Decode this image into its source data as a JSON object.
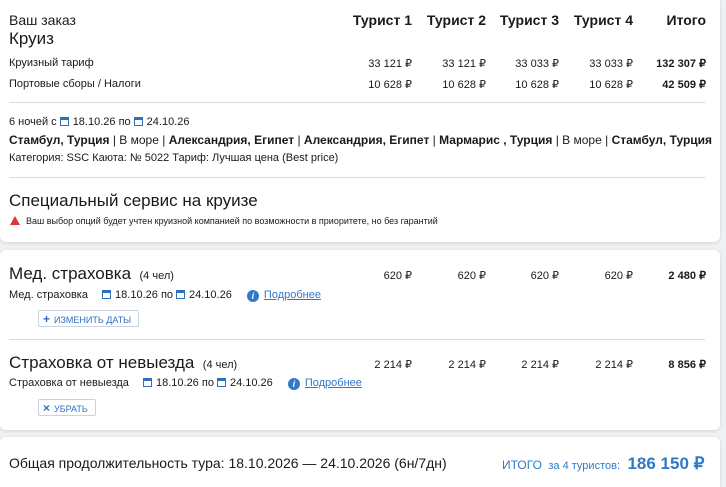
{
  "order": {
    "title": "Ваш заказ",
    "subtitle": "Круиз",
    "columns": [
      "Турист 1",
      "Турист 2",
      "Турист 3",
      "Турист 4",
      "Итого"
    ],
    "rows": [
      {
        "label": "Круизный тариф",
        "values": [
          "33 121 ₽",
          "33 121 ₽",
          "33 033 ₽",
          "33 033 ₽",
          "132 307 ₽"
        ]
      },
      {
        "label": "Портовые сборы / Налоги",
        "values": [
          "10 628 ₽",
          "10 628 ₽",
          "10 628 ₽",
          "10 628 ₽",
          "42 509 ₽"
        ]
      }
    ]
  },
  "itinerary": {
    "nights_prefix": "6 ночей с",
    "date_from": "18.10.26",
    "by": "по",
    "date_to": "24.10.26",
    "route": [
      {
        "text": "Стамбул, Турция",
        "bold": true
      },
      {
        "text": " | ",
        "bold": false
      },
      {
        "text": "В море",
        "bold": false
      },
      {
        "text": " | ",
        "bold": false
      },
      {
        "text": "Александрия, Египет",
        "bold": true
      },
      {
        "text": " | ",
        "bold": false
      },
      {
        "text": "Александрия, Египет",
        "bold": true
      },
      {
        "text": " | ",
        "bold": false
      },
      {
        "text": "Мармарис , Турция",
        "bold": true
      },
      {
        "text": " | ",
        "bold": false
      },
      {
        "text": "В море",
        "bold": false
      },
      {
        "text": " | ",
        "bold": false
      },
      {
        "text": "Стамбул, Турция",
        "bold": true
      }
    ],
    "details": "Категория: SSC  Каюта: № 5022  Тариф: Лучшая цена (Best price)"
  },
  "special": {
    "title": "Специальный сервис на круизе",
    "warning": "Ваш выбор опций будет учтен круизной компанией по возможности в приоритете, но без гарантий"
  },
  "medical": {
    "title": "Мед. страховка",
    "count": "(4 чел)",
    "values": [
      "620 ₽",
      "620 ₽",
      "620 ₽",
      "620 ₽",
      "2 480 ₽"
    ],
    "sub_label": "Мед. страховка",
    "date_from": "18.10.26",
    "by": "по",
    "date_to": "24.10.26",
    "more_link": "Подробнее",
    "button": "ИЗМЕНИТЬ ДАТЫ"
  },
  "cancel": {
    "title": "Страховка от невыезда",
    "count": "(4 чел)",
    "values": [
      "2 214 ₽",
      "2 214 ₽",
      "2 214 ₽",
      "2 214 ₽",
      "8 856 ₽"
    ],
    "sub_label": "Страховка от невыезда",
    "date_from": "18.10.26",
    "by": "по",
    "date_to": "24.10.26",
    "more_link": "Подробнее",
    "button": "УБРАТЬ"
  },
  "footer": {
    "duration": "Общая продолжительность тура: 18.10.2026 — 24.10.2026 (6н/7дн)",
    "total_label": "ИТОГО",
    "total_for": "за 4 туристов:",
    "total_value": "186 150 ₽"
  },
  "colors": {
    "accent": "#2f79c8",
    "warning": "#d9363e"
  }
}
